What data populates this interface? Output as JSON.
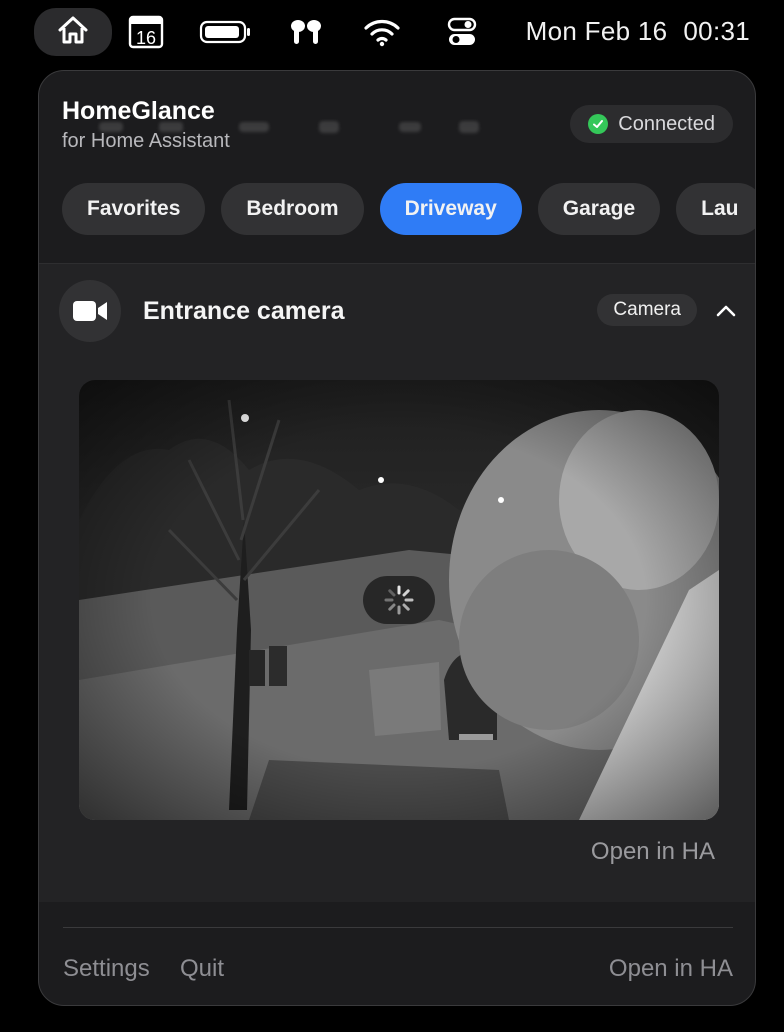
{
  "menubar": {
    "icons": [
      "home-icon",
      "calendar-icon",
      "battery-icon",
      "airpods-icon",
      "wifi-icon",
      "control-center-icon"
    ],
    "calendar_day": "16",
    "date": "Mon Feb 16",
    "time": "00:31"
  },
  "app": {
    "title": "HomeGlance",
    "subtitle": "for Home Assistant",
    "status": "Connected",
    "status_color": "#34c759"
  },
  "tabs": [
    {
      "label": "Favorites",
      "active": false
    },
    {
      "label": "Bedroom",
      "active": false
    },
    {
      "label": "Driveway",
      "active": true
    },
    {
      "label": "Garage",
      "active": false
    },
    {
      "label": "Lau",
      "active": false
    }
  ],
  "accent_color": "#2f7cf6",
  "entity": {
    "name": "Entrance camera",
    "type_badge": "Camera",
    "icon": "video-camera-icon",
    "expanded": true,
    "open_label": "Open in HA"
  },
  "footer": {
    "settings": "Settings",
    "quit": "Quit",
    "open_ha": "Open in HA"
  }
}
